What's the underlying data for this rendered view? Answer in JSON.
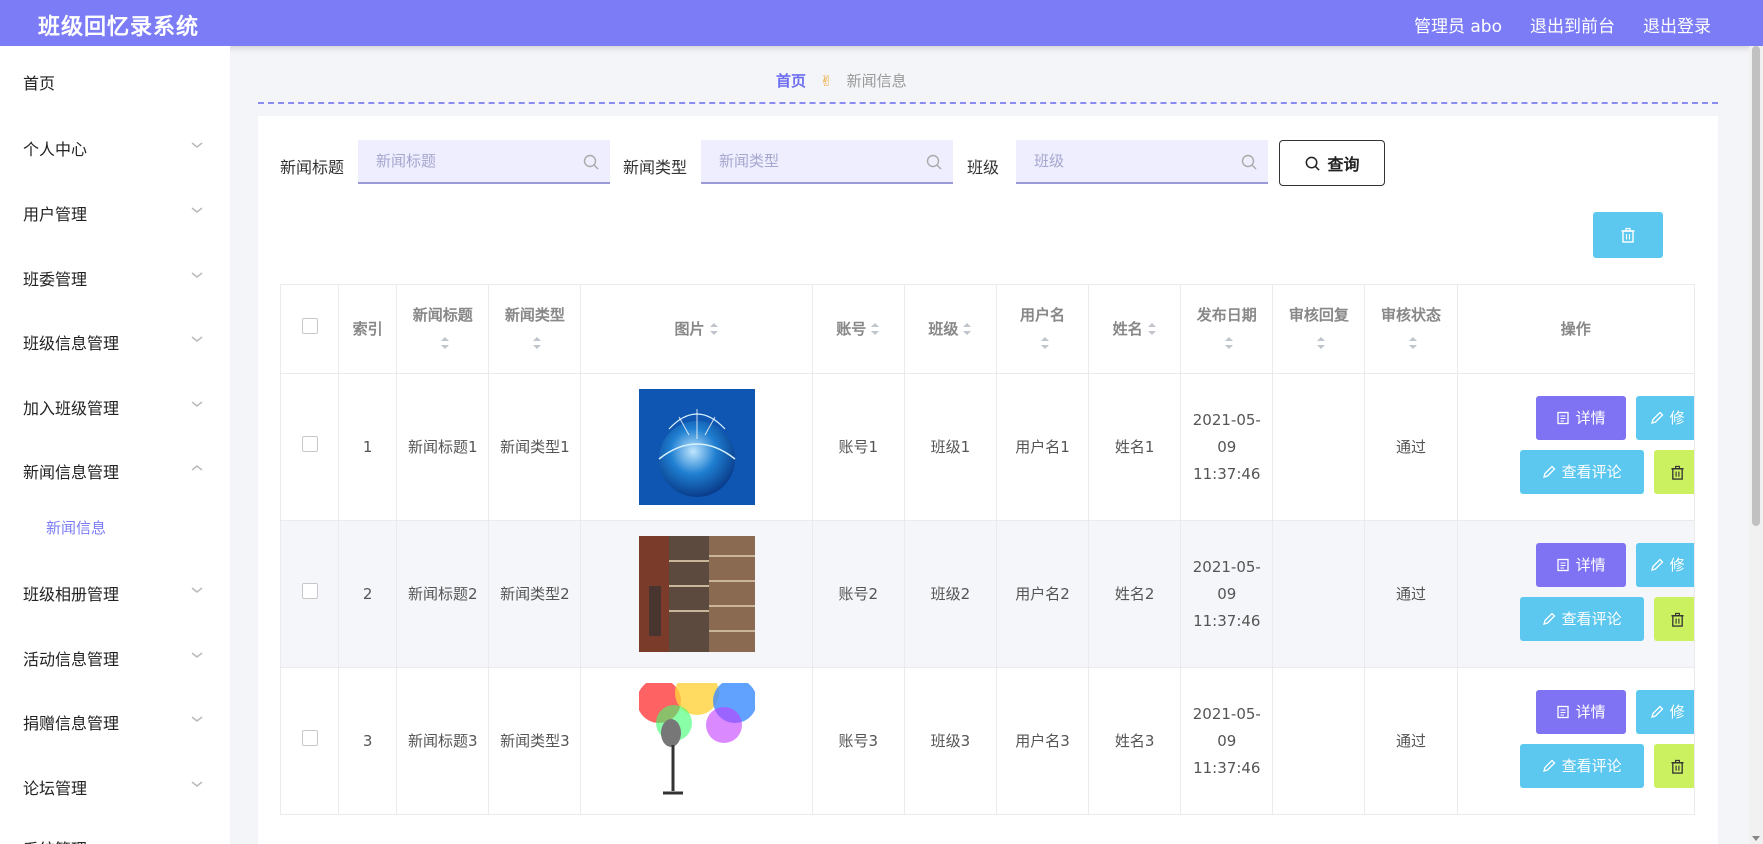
{
  "app": {
    "title": "班级回忆录系统"
  },
  "header": {
    "admin_label": "管理员 abo",
    "to_front": "退出到前台",
    "logout": "退出登录"
  },
  "sidebar": {
    "home": "首页",
    "items": [
      "个人中心",
      "用户管理",
      "班委管理",
      "班级信息管理",
      "加入班级管理",
      "新闻信息管理",
      "班级相册管理",
      "活动信息管理",
      "捐赠信息管理",
      "论坛管理",
      "系统管理"
    ],
    "sub_item": "新闻信息"
  },
  "breadcrumb": {
    "home": "首页",
    "current": "新闻信息"
  },
  "search": {
    "title_label": "新闻标题",
    "title_placeholder": "新闻标题",
    "type_label": "新闻类型",
    "type_placeholder": "新闻类型",
    "class_label": "班级",
    "class_placeholder": "班级",
    "query_button": "查询"
  },
  "table": {
    "headers": {
      "index": "索引",
      "title": "新闻标题",
      "type": "新闻类型",
      "image": "图片",
      "account": "账号",
      "class": "班级",
      "username": "用户名",
      "name": "姓名",
      "date": "发布日期",
      "reply": "审核回复",
      "status": "审核状态",
      "ops": "操作"
    },
    "buttons": {
      "detail": "详情",
      "edit": "修",
      "comment": "查看评论"
    },
    "rows": [
      {
        "index": "1",
        "title": "新闻标题1",
        "type": "新闻类型1",
        "account": "账号1",
        "class": "班级1",
        "username": "用户名1",
        "name": "姓名1",
        "date": "2021-05-09 11:37:46",
        "reply": "",
        "status": "通过"
      },
      {
        "index": "2",
        "title": "新闻标题2",
        "type": "新闻类型2",
        "account": "账号2",
        "class": "班级2",
        "username": "用户名2",
        "name": "姓名2",
        "date": "2021-05-09 11:37:46",
        "reply": "",
        "status": "通过"
      },
      {
        "index": "3",
        "title": "新闻标题3",
        "type": "新闻类型3",
        "account": "账号3",
        "class": "班级3",
        "username": "用户名3",
        "name": "姓名3",
        "date": "2021-05-09 11:37:46",
        "reply": "",
        "status": "通过"
      }
    ]
  },
  "colors": {
    "accent": "#7b7cf6",
    "detail_btn": "#7f73f3",
    "info_btn": "#5cc7ef",
    "delete_btn": "#ccf160"
  }
}
